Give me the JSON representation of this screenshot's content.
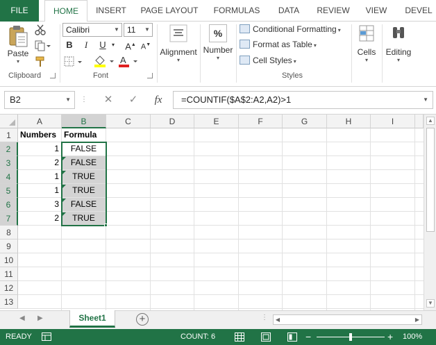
{
  "ribbon_tabs": [
    "FILE",
    "HOME",
    "INSERT",
    "PAGE LAYOUT",
    "FORMULAS",
    "DATA",
    "REVIEW",
    "VIEW",
    "DEVEL"
  ],
  "clipboard": {
    "paste": "Paste",
    "label": "Clipboard"
  },
  "font": {
    "name": "Calibri",
    "size": "11",
    "bold": "B",
    "italic": "I",
    "underline": "U",
    "grow": "A",
    "shrink": "A",
    "label": "Font"
  },
  "alignment": {
    "label": "Alignment"
  },
  "number": {
    "symbol": "%",
    "label": "Number"
  },
  "styles": {
    "conditional": "Conditional Formatting",
    "format_table": "Format as Table",
    "cell_styles": "Cell Styles",
    "label": "Styles"
  },
  "cells": {
    "label": "Cells"
  },
  "editing": {
    "label": "Editing"
  },
  "formula_bar": {
    "name_box": "B2",
    "cancel": "✕",
    "enter": "✓",
    "fx": "fx",
    "formula": "=COUNTIF($A$2:A2,A2)>1"
  },
  "columns": [
    "A",
    "B",
    "C",
    "D",
    "E",
    "F",
    "G",
    "H",
    "I"
  ],
  "rows": [
    "1",
    "2",
    "3",
    "4",
    "5",
    "6",
    "7",
    "8",
    "9",
    "10",
    "11",
    "12",
    "13"
  ],
  "cells_data": {
    "a1": "Numbers",
    "b1": "Formula",
    "a2": "1",
    "b2": "FALSE",
    "a3": "2",
    "b3": "FALSE",
    "a4": "1",
    "b4": "TRUE",
    "a5": "1",
    "b5": "TRUE",
    "a6": "3",
    "b6": "FALSE",
    "a7": "2",
    "b7": "TRUE"
  },
  "sheet_tabs": [
    "Sheet1"
  ],
  "status": {
    "ready": "READY",
    "count": "COUNT: 6",
    "zoom": "100%"
  },
  "colors": {
    "accent": "#217346",
    "selection": "#d3d3d3"
  }
}
